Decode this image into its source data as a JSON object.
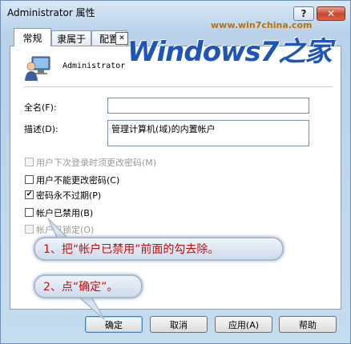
{
  "window": {
    "title": "Administrator 属性",
    "help_label": "?",
    "close_label": "✕"
  },
  "tabs": [
    {
      "label": "常规",
      "active": true
    },
    {
      "label": "隶属于",
      "active": false
    },
    {
      "label": "配置",
      "active": false
    }
  ],
  "watermark": {
    "url": "www.win7china.com",
    "logo": "Windows7之家"
  },
  "user": {
    "name": "Administrator",
    "icon": "user-computer-icon"
  },
  "fields": {
    "fullname": {
      "label": "全名(F):",
      "value": ""
    },
    "description": {
      "label": "描述(D):",
      "value": "管理计算机(域)的内置帐户"
    }
  },
  "options": [
    {
      "label": "用户下次登录时须更改密码(M)",
      "checked": false,
      "enabled": false
    },
    {
      "label": "用户不能更改密码(C)",
      "checked": false,
      "enabled": true
    },
    {
      "label": "密码永不过期(P)",
      "checked": true,
      "enabled": true
    },
    {
      "label": "帐户已禁用(B)",
      "checked": false,
      "enabled": true
    },
    {
      "label": "帐户已锁定(O)",
      "checked": false,
      "enabled": false
    }
  ],
  "callouts": {
    "step1": "1、把“帐户已禁用”前面的勾去除。",
    "step2": "2、点“确定”。"
  },
  "buttons": {
    "ok": "确定",
    "cancel": "取消",
    "apply": "应用(A)",
    "help": "帮助"
  },
  "colors": {
    "callout_text": "#c01010",
    "watermark_logo": "#1f55b8",
    "close_button": "#c7452a"
  }
}
